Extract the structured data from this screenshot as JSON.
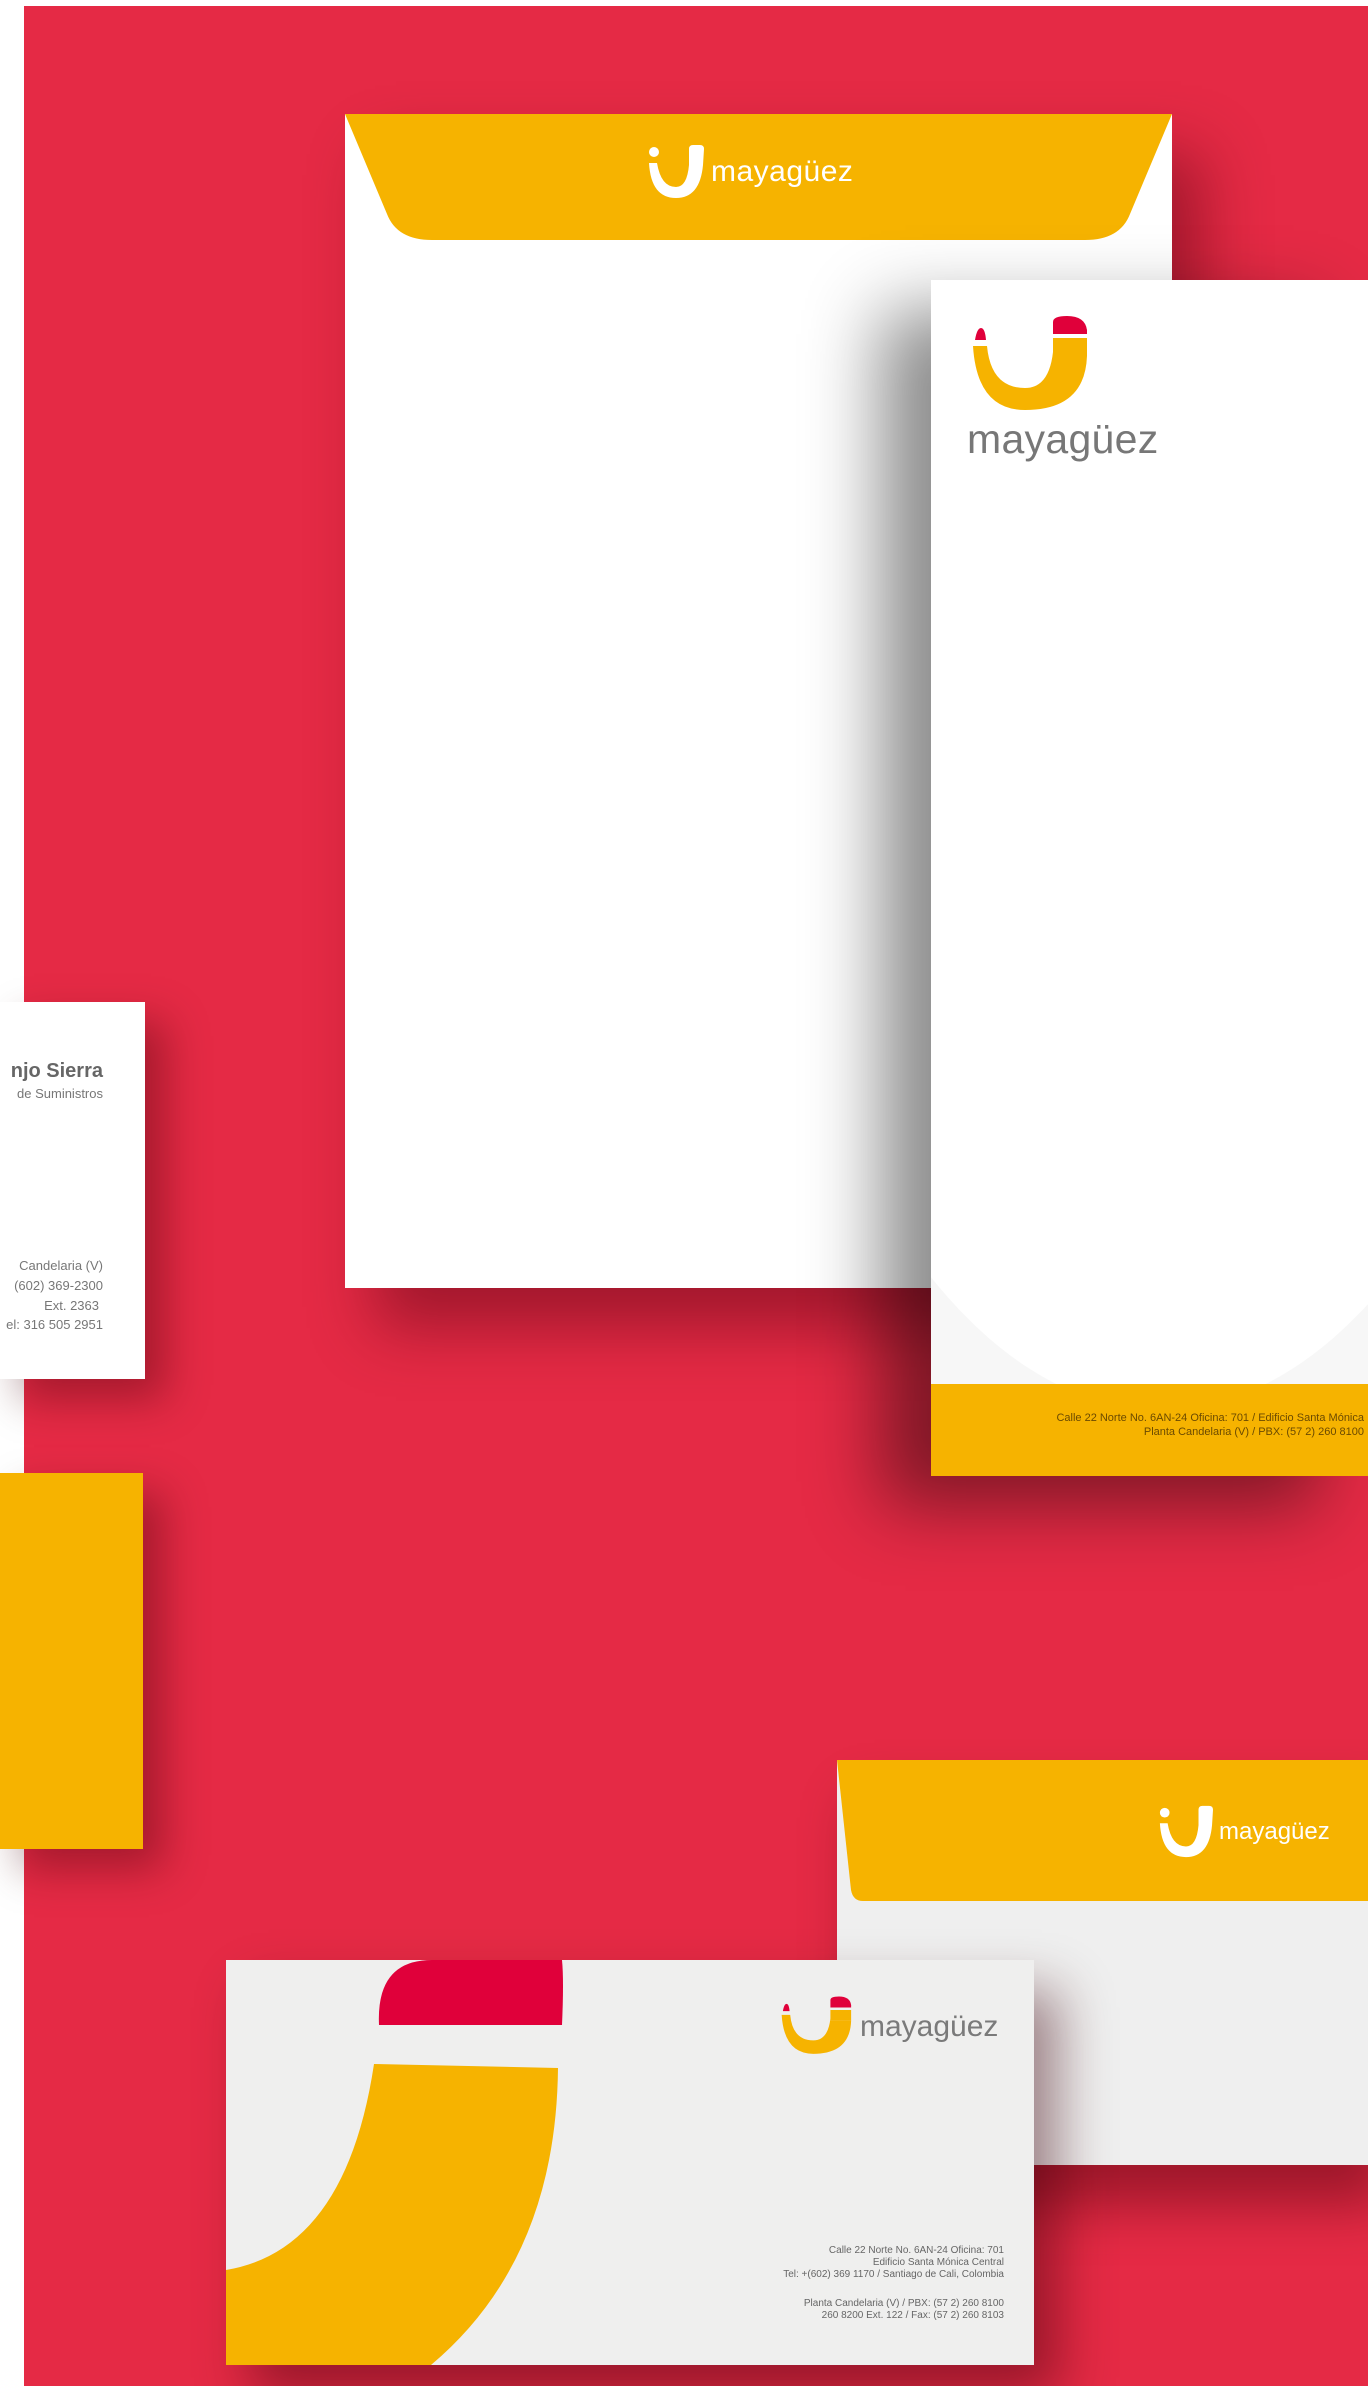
{
  "brand": {
    "name": "mayagüez",
    "colors": {
      "red": "#e52a45",
      "yellow": "#f6b300",
      "gray": "#777777",
      "logo_red": "#e0003a"
    }
  },
  "letterhead": {
    "address_line1": "Calle 22 Norte No. 6AN-24 Oficina: 701 / Edificio Santa Mónica",
    "address_line2": "Planta Candelaria (V) / PBX: (57 2) 260 8100"
  },
  "business_card": {
    "name": "njo Sierra",
    "title": "de Suministros",
    "lines": [
      "Candelaria (V)",
      "(602) 369-2300",
      "Ext. 2363",
      "el: 316 505 2951"
    ]
  },
  "long_envelope": {
    "address": [
      "Calle 22 Norte No. 6AN-24 Oficina: 701",
      "Edificio Santa Mónica Central",
      "Tel: +(602) 369 1170 / Santiago de Cali, Colombia"
    ],
    "plant": [
      "Planta Candelaria (V) / PBX: (57 2) 260 8100",
      "260 8200 Ext. 122 / Fax: (57 2) 260 8103"
    ]
  }
}
